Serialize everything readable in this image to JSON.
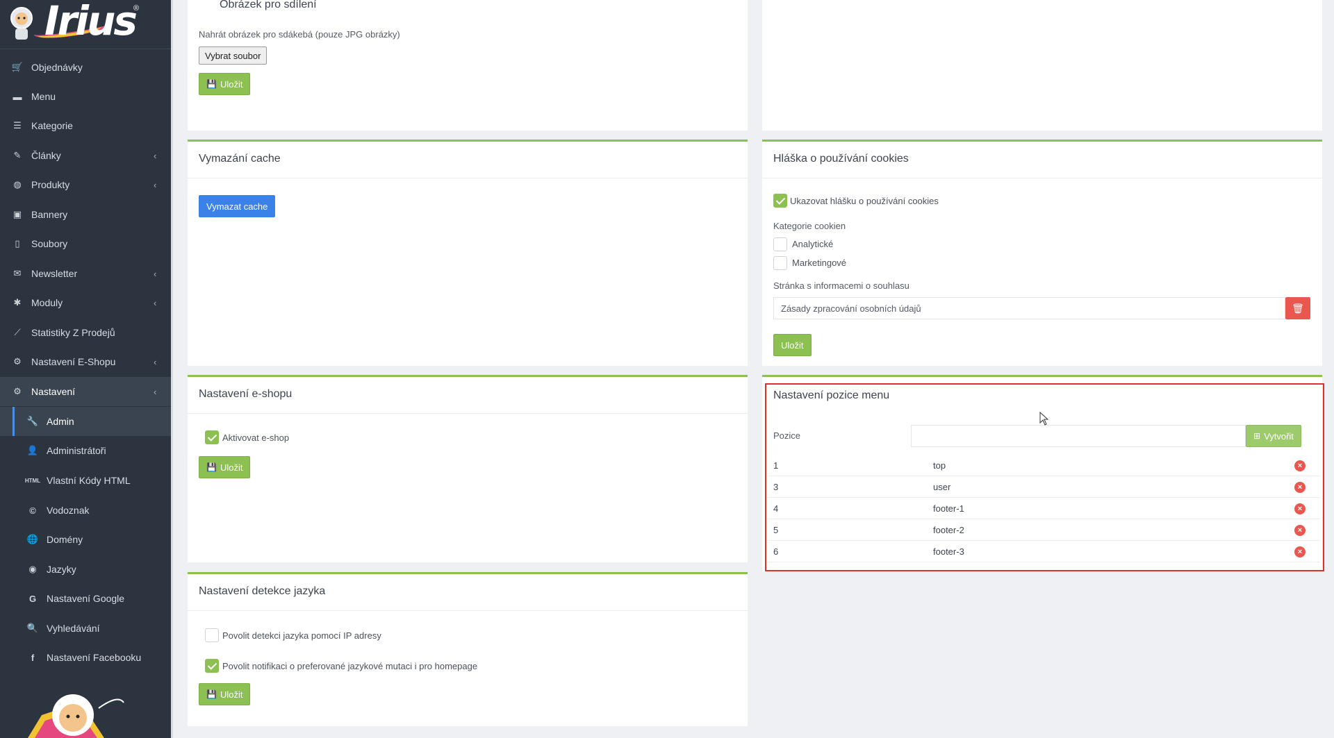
{
  "colors": {
    "sidebar_bg": "#2c3440",
    "accent_green": "#8cc152",
    "accent_blue": "#3b82e8",
    "danger_red": "#e9574f",
    "highlight": "#e0302a"
  },
  "brand": {
    "logo_text": "Irius",
    "logo_reg": "®"
  },
  "sidebar": {
    "items": [
      {
        "label": "Objednávky",
        "icon": "cart-icon",
        "glyph": "🛒",
        "chevron": false
      },
      {
        "label": "Menu",
        "icon": "folder-icon",
        "glyph": "▬",
        "chevron": false
      },
      {
        "label": "Kategorie",
        "icon": "list-icon",
        "glyph": "☰",
        "chevron": false
      },
      {
        "label": "Články",
        "icon": "pencil-icon",
        "glyph": "✎",
        "chevron": true
      },
      {
        "label": "Produkty",
        "icon": "basketball-icon",
        "glyph": "◍",
        "chevron": true
      },
      {
        "label": "Bannery",
        "icon": "image-icon",
        "glyph": "▣",
        "chevron": false
      },
      {
        "label": "Soubory",
        "icon": "file-icon",
        "glyph": "▯",
        "chevron": false
      },
      {
        "label": "Newsletter",
        "icon": "mail-circle-icon",
        "glyph": "✉",
        "chevron": true
      },
      {
        "label": "Moduly",
        "icon": "puzzle-icon",
        "glyph": "✱",
        "chevron": true
      },
      {
        "label": "Statistiky Z Prodejů",
        "icon": "chart-line-icon",
        "glyph": "⟋",
        "chevron": false
      },
      {
        "label": "Nastavení E-Shopu",
        "icon": "cogs-icon",
        "glyph": "⚙",
        "chevron": true
      },
      {
        "label": "Nastavení",
        "icon": "cogs-icon",
        "glyph": "⚙",
        "chevron": true
      }
    ],
    "sub_items": [
      {
        "label": "Admin",
        "icon": "wrench-icon",
        "glyph": "🔧"
      },
      {
        "label": "Administrátoři",
        "icon": "user-icon",
        "glyph": "👤"
      },
      {
        "label": "Vlastní Kódy HTML",
        "icon": "html-icon",
        "glyph": "HTML"
      },
      {
        "label": "Vodoznak",
        "icon": "copyright-icon",
        "glyph": "©"
      },
      {
        "label": "Domény",
        "icon": "globe-icon",
        "glyph": "🌐"
      },
      {
        "label": "Jazyky",
        "icon": "language-globe-icon",
        "glyph": "◉"
      },
      {
        "label": "Nastavení Google",
        "icon": "google-icon",
        "glyph": "G"
      },
      {
        "label": "Vyhledávání",
        "icon": "search-icon",
        "glyph": "🔍"
      },
      {
        "label": "Nastavení Facebooku",
        "icon": "facebook-icon",
        "glyph": "f"
      }
    ]
  },
  "share_card": {
    "title": "Obrázek pro sdílení",
    "upload_label": "Nahrát obrázek pro sdákebá (pouze JPG obrázky)",
    "file_button": "Vybrat soubor",
    "save_label": "Uložit"
  },
  "cache_card": {
    "title": "Vymazání cache",
    "button_label": "Vymazat cache"
  },
  "cookies_card": {
    "title": "Hláška o používání cookies",
    "show_label": "Ukazovat hlášku o používání cookies",
    "show_checked": true,
    "categories_label": "Kategorie cookien",
    "analytics_label": "Analytické",
    "analytics_checked": false,
    "marketing_label": "Marketingové",
    "marketing_checked": false,
    "consent_page_label": "Stránka s informacemi o souhlasu",
    "consent_page_value": "Zásady zpracování osobních údajů",
    "save_label": "Uložit"
  },
  "eshop_card": {
    "title": "Nastavení e-shopu",
    "activate_label": "Aktivovat e-shop",
    "activate_checked": true,
    "save_label": "Uložit"
  },
  "menu_position_card": {
    "title": "Nastavení pozice menu",
    "position_label": "Pozice",
    "position_value": "",
    "create_label": "Vytvořit",
    "rows": [
      {
        "id": "1",
        "name": "top"
      },
      {
        "id": "3",
        "name": "user"
      },
      {
        "id": "4",
        "name": "footer-1"
      },
      {
        "id": "5",
        "name": "footer-2"
      },
      {
        "id": "6",
        "name": "footer-3"
      }
    ]
  },
  "language_card": {
    "title": "Nastavení detekce jazyka",
    "ip_detect_label": "Povolit detekci jazyka pomocí IP adresy",
    "ip_detect_checked": false,
    "notify_label": "Povolit notifikaci o preferované jazykové mutaci i pro homepage",
    "notify_checked": true,
    "save_label": "Uložit"
  }
}
